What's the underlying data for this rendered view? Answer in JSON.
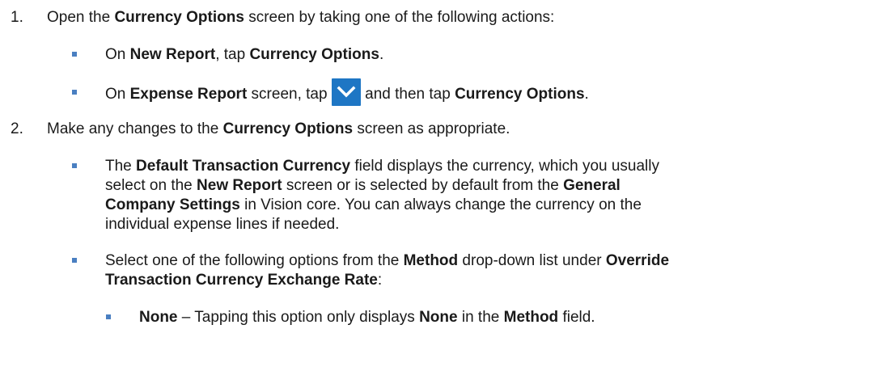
{
  "step1": {
    "number": "1.",
    "a": "Open the ",
    "b": "Currency Options",
    "c": " screen by taking one of the following actions:"
  },
  "bullet1": {
    "a": "On ",
    "b": "New Report",
    "c": ", tap ",
    "d": "Currency Options",
    "e": "."
  },
  "bullet2": {
    "a": "On ",
    "b": "Expense Report",
    "c": " screen, tap ",
    "icon": "chevron-down-icon",
    "d": " and then tap ",
    "e": "Currency Options",
    "f": "."
  },
  "step2": {
    "number": "2.",
    "a": "Make any changes to the ",
    "b": "Currency Options",
    "c": " screen as appropriate."
  },
  "bullet3": {
    "l1a": "The ",
    "l1b": "Default Transaction Currency",
    "l1c": " field displays the currency, which you usually",
    "l2a": "select on the ",
    "l2b": "New Report",
    "l2c": " screen or is selected by default from the ",
    "l2d": "General",
    "l3a": "Company Settings",
    "l3b": " in Vision core. You can always change the currency on the",
    "l4a": "individual expense lines if needed."
  },
  "bullet4": {
    "l1a": "Select one of the following options from the ",
    "l1b": "Method",
    "l1c": " drop-down list under ",
    "l1d": "Override",
    "l2a": "Transaction Currency Exchange Rate",
    "l2b": ":"
  },
  "sub1": {
    "a": "None",
    "b": " – Tapping this option only displays ",
    "c": "None",
    "d": " in the ",
    "e": "Method",
    "f": " field."
  },
  "colors": {
    "bullet": "#4a7fc1",
    "icon_bg": "#1e76c4"
  }
}
